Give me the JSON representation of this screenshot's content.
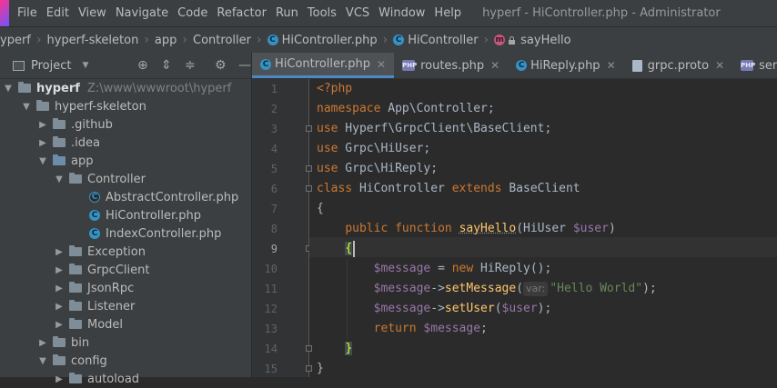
{
  "menubar": {
    "items": [
      "File",
      "Edit",
      "View",
      "Navigate",
      "Code",
      "Refactor",
      "Run",
      "Tools",
      "VCS",
      "Window",
      "Help"
    ],
    "window_title": "hyperf - HiController.php - Administrator"
  },
  "breadcrumb": [
    "yperf",
    "hyperf-skeleton",
    "app",
    "Controller",
    "HiController.php",
    "HiController",
    "sayHello"
  ],
  "sidebar": {
    "title": "Project",
    "root_label": "hyperf",
    "root_path": "Z:\\www\\wwwroot\\hyperf",
    "items": [
      {
        "label": "hyperf-skeleton"
      },
      {
        "label": ".github"
      },
      {
        "label": ".idea"
      },
      {
        "label": "app"
      },
      {
        "label": "Controller"
      },
      {
        "label": "AbstractController.php"
      },
      {
        "label": "HiController.php"
      },
      {
        "label": "IndexController.php"
      },
      {
        "label": "Exception"
      },
      {
        "label": "GrpcClient"
      },
      {
        "label": "JsonRpc"
      },
      {
        "label": "Listener"
      },
      {
        "label": "Model"
      },
      {
        "label": "bin"
      },
      {
        "label": "config"
      },
      {
        "label": "autoload"
      }
    ]
  },
  "tabs": [
    {
      "label": "HiController.php",
      "active": true
    },
    {
      "label": "routes.php",
      "active": false
    },
    {
      "label": "HiReply.php",
      "active": false
    },
    {
      "label": "grpc.proto",
      "active": false
    },
    {
      "label": "server.php",
      "active": false
    }
  ],
  "editor": {
    "line_numbers": [
      "1",
      "2",
      "3",
      "4",
      "5",
      "6",
      "7",
      "8",
      "9",
      "10",
      "11",
      "12",
      "13",
      "14",
      "15"
    ],
    "current_line": "9",
    "tokens": {
      "l1": "<?php",
      "l2_kw": "namespace",
      "l2_ns": " App\\Controller;",
      "l3_kw": "use",
      "l3_ns": " Hyperf\\GrpcClient\\BaseClient;",
      "l4_kw": "use",
      "l4_ns": " Grpc\\HiUser;",
      "l5_kw": "use",
      "l5_ns": " Grpc\\HiReply;",
      "l6_kw1": "class",
      "l6_name": " HiController ",
      "l6_kw2": "extends",
      "l6_base": " BaseClient",
      "l7": "{",
      "l8_kw1": "public",
      "l8_kw2": "function",
      "l8_fn": "sayHello",
      "l8_p1": "(HiUser ",
      "l8_var": "$user",
      "l8_p2": ")",
      "l9": "{",
      "l10_var": "$message",
      "l10_eq": " = ",
      "l10_kw": "new",
      "l10_rest": " HiReply();",
      "l11_var": "$message",
      "l11_arrow": "->",
      "l11_fn": "setMessage",
      "l11_paren": "(",
      "l11_hint": "var:",
      "l11_str": "\"Hello World\"",
      "l11_end": ");",
      "l12_var": "$message",
      "l12_arrow": "->",
      "l12_fn": "setUser",
      "l12_paren": "(",
      "l12_arg": "$user",
      "l12_end": ");",
      "l13_kw": "return",
      "l13_sp": " ",
      "l13_var": "$message",
      "l13_end": ";",
      "l14": "}",
      "l15": "}"
    }
  },
  "colors": {
    "keyword": "#cc7832",
    "variable": "#9876aa",
    "function": "#ffc66d",
    "string": "#6a8759",
    "text": "#a9b7c6",
    "accent": "#4a88c7"
  }
}
